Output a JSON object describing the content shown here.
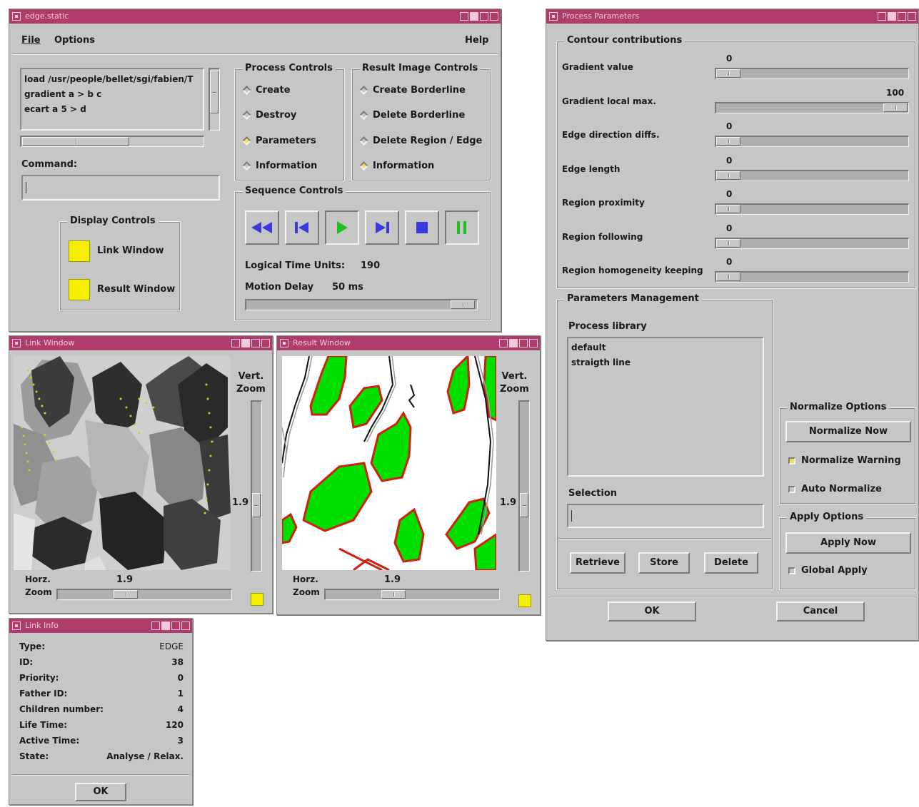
{
  "edge_win": {
    "title": "edge.static",
    "menu_file": "File",
    "menu_options": "Options",
    "menu_help": "Help",
    "log_lines": [
      "load /usr/people/bellet/sgi/fabien/T",
      "gradient a > b c",
      "ecart a 5 > d"
    ],
    "command_label": "Command:",
    "command_value": "",
    "display_controls": {
      "title": "Display Controls",
      "link_window": "Link Window",
      "result_window": "Result Window"
    },
    "process_controls": {
      "title": "Process Controls",
      "items": [
        "Create",
        "Destroy",
        "Parameters",
        "Information"
      ],
      "selected": "Parameters"
    },
    "result_controls": {
      "title": "Result Image Controls",
      "items": [
        "Create Borderline",
        "Delete Borderline",
        "Delete Region / Edge",
        "Information"
      ],
      "selected": "Information"
    },
    "sequence_controls": {
      "title": "Sequence Controls",
      "time_units_label": "Logical Time Units:",
      "time_units_value": "190",
      "motion_delay_label": "Motion Delay",
      "motion_delay_value": "50 ms"
    }
  },
  "link_window": {
    "title": "Link Window",
    "vert_zoom_label_1": "Vert.",
    "vert_zoom_label_2": "Zoom",
    "vert_zoom_value": "1.9",
    "horz_label": "Horz.",
    "zoom_label": "Zoom",
    "horz_zoom_value": "1.9"
  },
  "result_window": {
    "title": "Result Window",
    "vert_zoom_label_1": "Vert.",
    "vert_zoom_label_2": "Zoom",
    "vert_zoom_value": "1.9",
    "horz_label": "Horz.",
    "zoom_label": "Zoom",
    "horz_zoom_value": "1.9"
  },
  "link_info": {
    "title": "Link Info",
    "rows": [
      {
        "label": "Type:",
        "value": "EDGE"
      },
      {
        "label": "ID:",
        "value": "38"
      },
      {
        "label": "Priority:",
        "value": "0"
      },
      {
        "label": "Father ID:",
        "value": "1"
      },
      {
        "label": "Children number:",
        "value": "4"
      },
      {
        "label": "Life Time:",
        "value": "120"
      },
      {
        "label": "Active Time:",
        "value": "3"
      },
      {
        "label": "State:",
        "value": "Analyse / Relax."
      }
    ],
    "ok": "OK"
  },
  "process_params": {
    "title": "Process Parameters",
    "contour_title": "Contour contributions",
    "params": [
      {
        "label": "Gradient value",
        "value": "0",
        "level": 0.0
      },
      {
        "label": "Gradient local max.",
        "value": "100",
        "level": 1.0
      },
      {
        "label": "Edge direction diffs.",
        "value": "0",
        "level": 0.0
      },
      {
        "label": "Edge length",
        "value": "0",
        "level": 0.0
      },
      {
        "label": "Region proximity",
        "value": "0",
        "level": 0.0
      },
      {
        "label": "Region following",
        "value": "0",
        "level": 0.0
      },
      {
        "label": "Region homogeneity keeping",
        "value": "0",
        "level": 0.0
      }
    ],
    "mgmt_title": "Parameters Management",
    "library_label": "Process library",
    "library_items": [
      "default",
      "straigth line"
    ],
    "selection_label": "Selection",
    "selection_value": "",
    "retrieve": "Retrieve",
    "store": "Store",
    "delete": "Delete",
    "normalize_title": "Normalize Options",
    "normalize_now": "Normalize Now",
    "normalize_warning": "Normalize Warning",
    "auto_normalize": "Auto Normalize",
    "apply_title": "Apply Options",
    "apply_now": "Apply Now",
    "global_apply": "Global Apply",
    "ok": "OK",
    "cancel": "Cancel"
  }
}
